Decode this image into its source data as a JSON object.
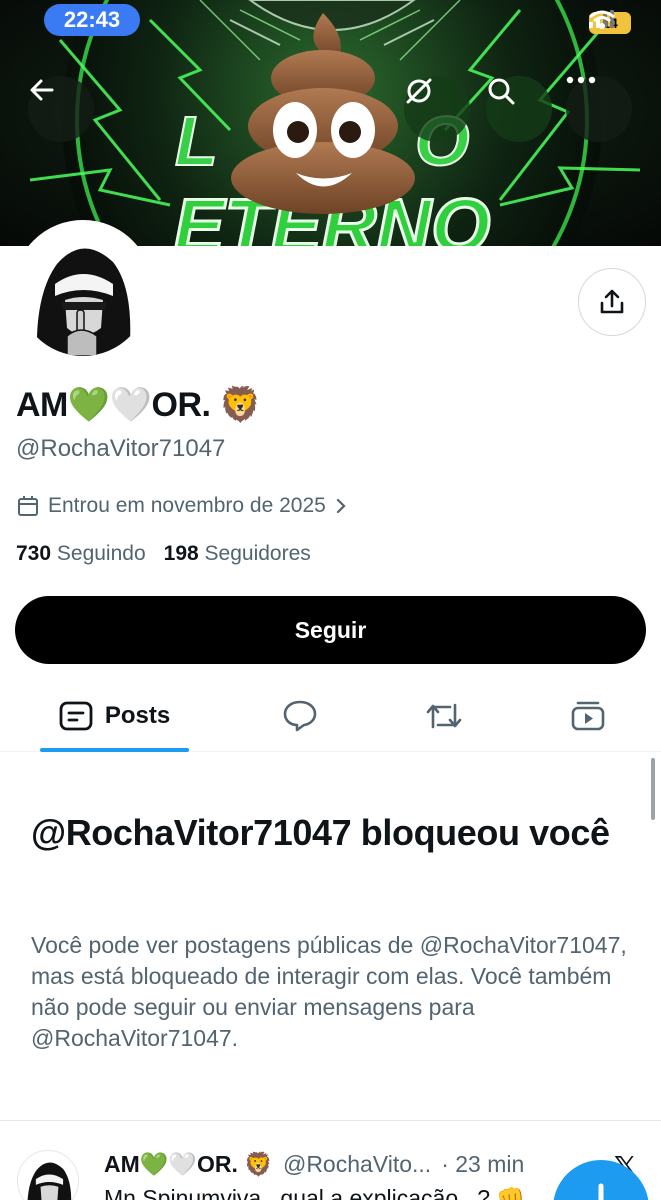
{
  "status_bar": {
    "time": "22:43",
    "battery": "14"
  },
  "banner": {
    "text": "ETERNO",
    "emoji": "💩"
  },
  "profile": {
    "display_name": "AM💚🤍OR. 🦁",
    "handle": "@RochaVitor71047",
    "joined": "Entrou em novembro de 2025",
    "following_count": "730",
    "following_label": "Seguindo",
    "followers_count": "198",
    "followers_label": "Seguidores"
  },
  "actions": {
    "follow_label": "Seguir"
  },
  "tabs": [
    {
      "label": "Posts",
      "icon": "posts-icon",
      "active": true
    },
    {
      "label": "",
      "icon": "replies-icon"
    },
    {
      "label": "",
      "icon": "reposts-icon"
    },
    {
      "label": "",
      "icon": "media-icon"
    }
  ],
  "blocked": {
    "title": "@RochaVitor71047 bloqueou você",
    "description": "Você pode ver postagens públicas de @RochaVitor71047, mas está bloqueado de interagir com elas. Você também não pode seguir ou enviar mensagens para @RochaVitor71047."
  },
  "post": {
    "name": "AM💚🤍OR. 🦁",
    "handle": "@RochaVito...",
    "time": "· 23 min",
    "text": "Mn Spinumviva.. qual a explicação...? 👊"
  },
  "colors": {
    "accent": "#1d9bf0",
    "text": "#0f1419",
    "muted": "#536471",
    "banner_green": "#39e04a"
  }
}
